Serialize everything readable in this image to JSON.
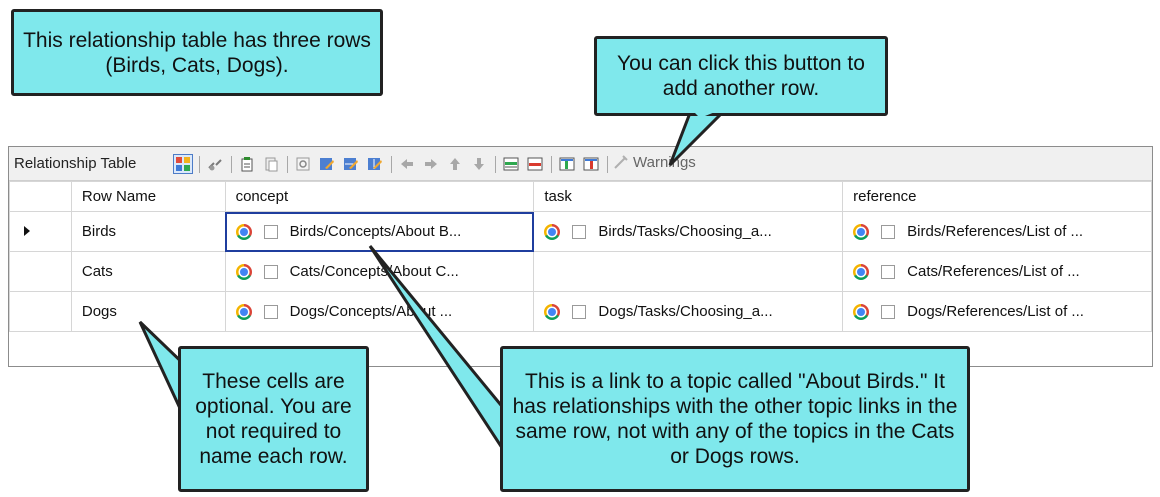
{
  "callouts": {
    "top_left": "This relationship table has three rows (Birds, Cats, Dogs).",
    "top_right": "You can click this button to add another row.",
    "bottom_left": "These cells are optional. You are not required to name each row.",
    "bottom_right": "This is a link to a topic called \"About Birds.\" It has relationships with the other topic links in the same row, not with any of the topics in the Cats or Dogs rows."
  },
  "toolbar": {
    "label": "Relationship Table",
    "warnings_label": "Warnings",
    "icons": [
      "grid-view-icon",
      "disconnect-icon",
      "new-column-icon",
      "paste-icon",
      "preview-icon",
      "edit-icon",
      "edit-row-icon",
      "edit-column-icon",
      "arrow-left-icon",
      "arrow-right-icon",
      "arrow-up-icon",
      "arrow-down-icon",
      "insert-row-icon",
      "delete-row-icon",
      "insert-column-icon",
      "delete-column-icon",
      "warnings-icon"
    ]
  },
  "table": {
    "headers": {
      "row_name": "Row Name",
      "concept": "concept",
      "task": "task",
      "reference": "reference"
    },
    "rows": [
      {
        "name": "Birds",
        "concept": "Birds/Concepts/About B...",
        "task": "Birds/Tasks/Choosing_a...",
        "reference": "Birds/References/List of ..."
      },
      {
        "name": "Cats",
        "concept": "Cats/Concepts/About C...",
        "task": "",
        "reference": "Cats/References/List of ..."
      },
      {
        "name": "Dogs",
        "concept": "Dogs/Concepts/About ...",
        "task": "Dogs/Tasks/Choosing_a...",
        "reference": "Dogs/References/List of ..."
      }
    ]
  },
  "colors": {
    "callout_fill": "#7fe8ec",
    "callout_border": "#222222",
    "selection": "#1f3e9e"
  }
}
